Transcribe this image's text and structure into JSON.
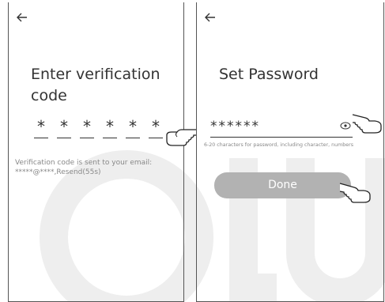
{
  "screen1": {
    "back_icon": "arrow-left-icon",
    "title": "Enter verification code",
    "code_chars": [
      "*",
      "*",
      "*",
      "*",
      "*",
      "*"
    ],
    "hint_line1": "Verification code is sent to your email:",
    "hint_line2": "*****@****,Resend(55s)"
  },
  "screen2": {
    "back_icon": "arrow-left-icon",
    "title": "Set Password",
    "password_mask": "******",
    "eye_icon": "eye-icon",
    "hint": "6-20 characters for password, including character, numbers",
    "done_label": "Done"
  },
  "colors": {
    "button_bg": "#b2b2b2",
    "watermark": "#eeeeee"
  }
}
